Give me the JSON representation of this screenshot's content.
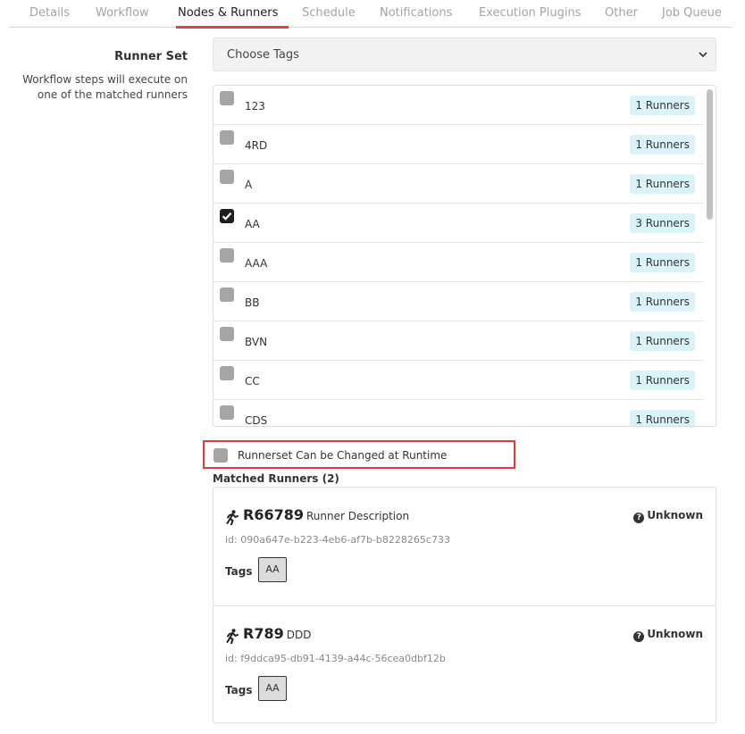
{
  "tabs": [
    {
      "label": "Details",
      "active": false
    },
    {
      "label": "Workflow",
      "active": false
    },
    {
      "label": "Nodes & Runners",
      "active": true
    },
    {
      "label": "Schedule",
      "active": false
    },
    {
      "label": "Notifications",
      "active": false
    },
    {
      "label": "Execution Plugins",
      "active": false
    },
    {
      "label": "Other",
      "active": false
    },
    {
      "label": "Job Queue",
      "active": false
    }
  ],
  "runner_set": {
    "title": "Runner Set",
    "help_line1": "Workflow steps will execute on",
    "help_line2": "one of the matched runners"
  },
  "tag_select": {
    "selected": "Choose Tags",
    "icon": "chevron-down-icon"
  },
  "tag_options": [
    {
      "name": "123",
      "count": "1 Runners",
      "checked": false
    },
    {
      "name": "4RD",
      "count": "1 Runners",
      "checked": false
    },
    {
      "name": "A",
      "count": "1 Runners",
      "checked": false
    },
    {
      "name": "AA",
      "count": "3 Runners",
      "checked": true
    },
    {
      "name": "AAA",
      "count": "1 Runners",
      "checked": false
    },
    {
      "name": "BB",
      "count": "1 Runners",
      "checked": false
    },
    {
      "name": "BVN",
      "count": "1 Runners",
      "checked": false
    },
    {
      "name": "CC",
      "count": "1 Runners",
      "checked": false
    },
    {
      "name": "CDS",
      "count": "1 Runners",
      "checked": false
    }
  ],
  "runtime_option": {
    "label": "Runnerset Can be Changed at Runtime",
    "checked": false
  },
  "matched": {
    "title": "Matched Runners (2)",
    "runners": [
      {
        "name": "R66789",
        "description": "Runner Description",
        "id": "id: 090a647e-b223-4eb6-af7b-b8228265c733",
        "tags_label": "Tags",
        "tags": [
          "AA"
        ],
        "status": "Unknown"
      },
      {
        "name": "R789",
        "description": "DDD",
        "id": "id: f9ddca95-db91-4139-a44c-56cea0dbf12b",
        "tags_label": "Tags",
        "tags": [
          "AA"
        ],
        "status": "Unknown"
      }
    ]
  },
  "colors": {
    "accent": "#e8413a",
    "pill_bg": "#d9f3f8",
    "checkbox_unchecked": "#a4a4a4",
    "checkbox_checked": "#1e1e1e"
  },
  "icons": {
    "runner": "running-person-icon",
    "status": "question-circle-icon",
    "check": "checkmark-icon"
  }
}
